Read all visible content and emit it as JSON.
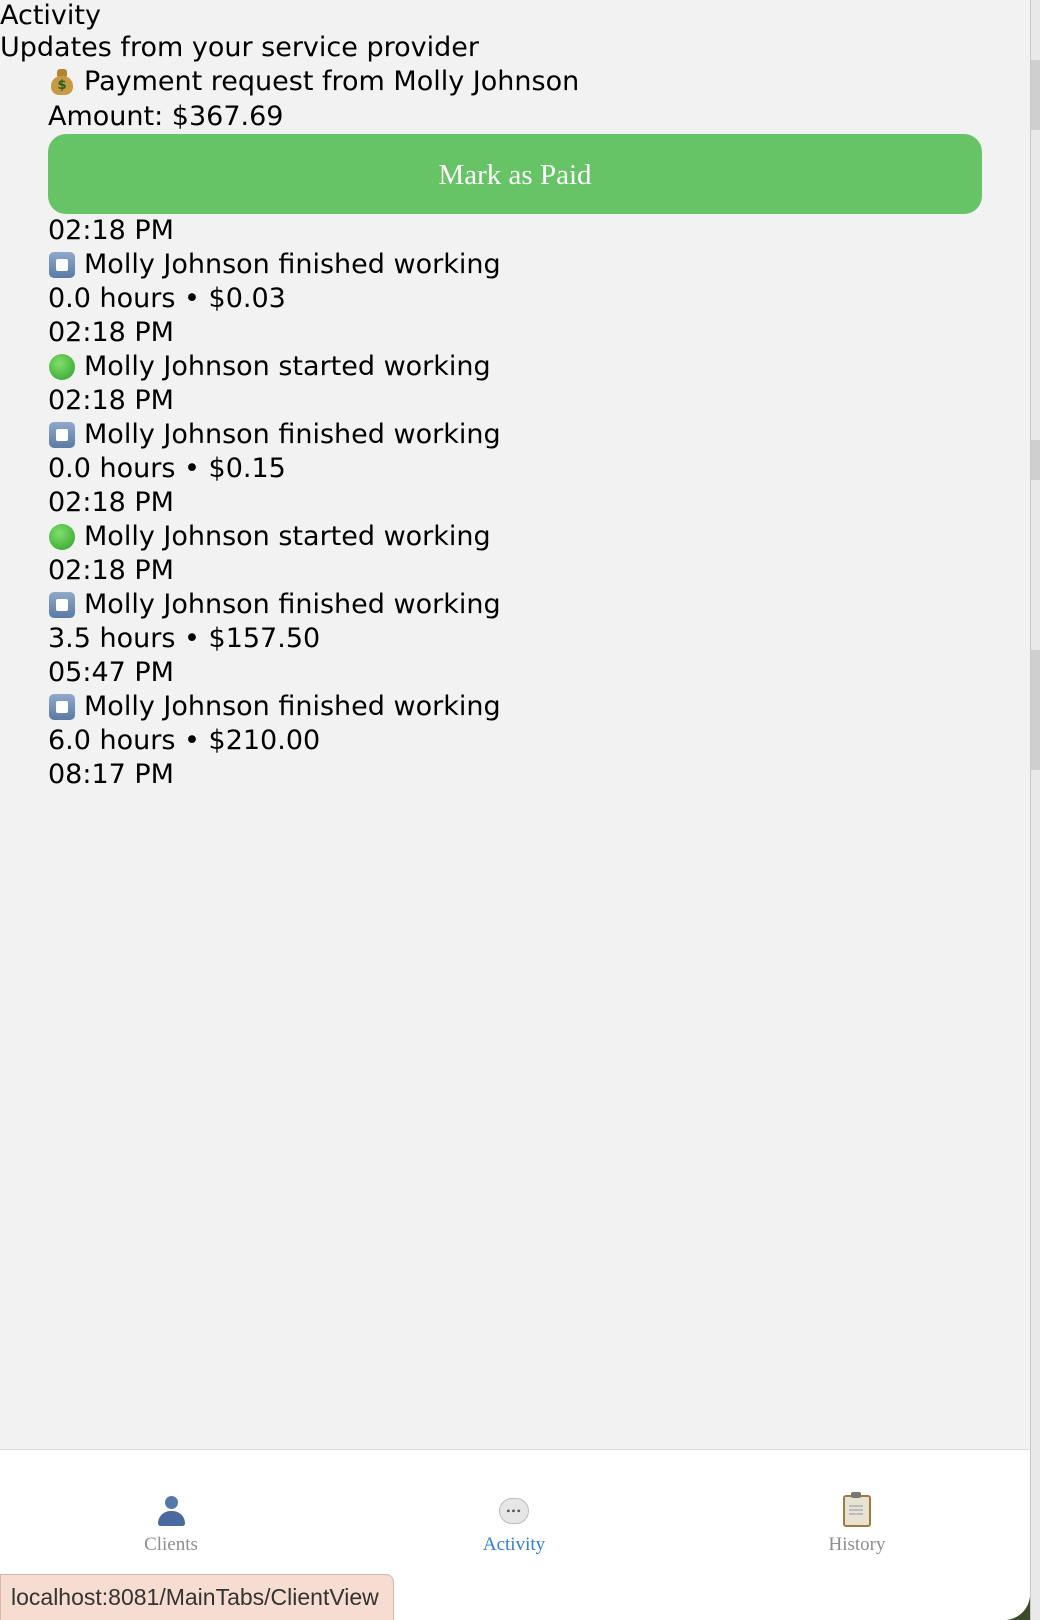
{
  "header": {
    "title": "Activity",
    "subtitle": "Updates from your service provider"
  },
  "payment_request": {
    "icon": "money-bag-icon",
    "title": "Payment request from Molly Johnson",
    "amount_text": "Amount: $367.69",
    "button_label": "Mark as Paid",
    "button_color": "#66c466",
    "time": "02:18 PM"
  },
  "events": [
    {
      "icon": "stop-icon",
      "text": "Molly Johnson finished working",
      "detail": "0.0 hours • $0.03",
      "time": "02:18 PM"
    },
    {
      "icon": "green-circle-icon",
      "text": "Molly Johnson started working",
      "detail": "",
      "time": "02:18 PM"
    },
    {
      "icon": "stop-icon",
      "text": "Molly Johnson finished working",
      "detail": "0.0 hours • $0.15",
      "time": "02:18 PM"
    },
    {
      "icon": "green-circle-icon",
      "text": "Molly Johnson started working",
      "detail": "",
      "time": "02:18 PM"
    },
    {
      "icon": "stop-icon",
      "text": "Molly Johnson finished working",
      "detail": "3.5 hours • $157.50",
      "time": "05:47 PM"
    },
    {
      "icon": "stop-icon",
      "text": "Molly Johnson finished working",
      "detail": "6.0 hours • $210.00",
      "time": "08:17 PM"
    }
  ],
  "tabs": [
    {
      "label": "Clients",
      "icon": "person-icon",
      "active": false
    },
    {
      "label": "Activity",
      "icon": "speech-bubble-icon",
      "active": true
    },
    {
      "label": "History",
      "icon": "clipboard-icon",
      "active": false
    }
  ],
  "colors": {
    "active_tab": "#2f7de1",
    "inactive_tab": "#8e8e8e",
    "background": "#f2f2f2"
  },
  "status_bar": {
    "url": "localhost:8081/MainTabs/ClientView"
  }
}
